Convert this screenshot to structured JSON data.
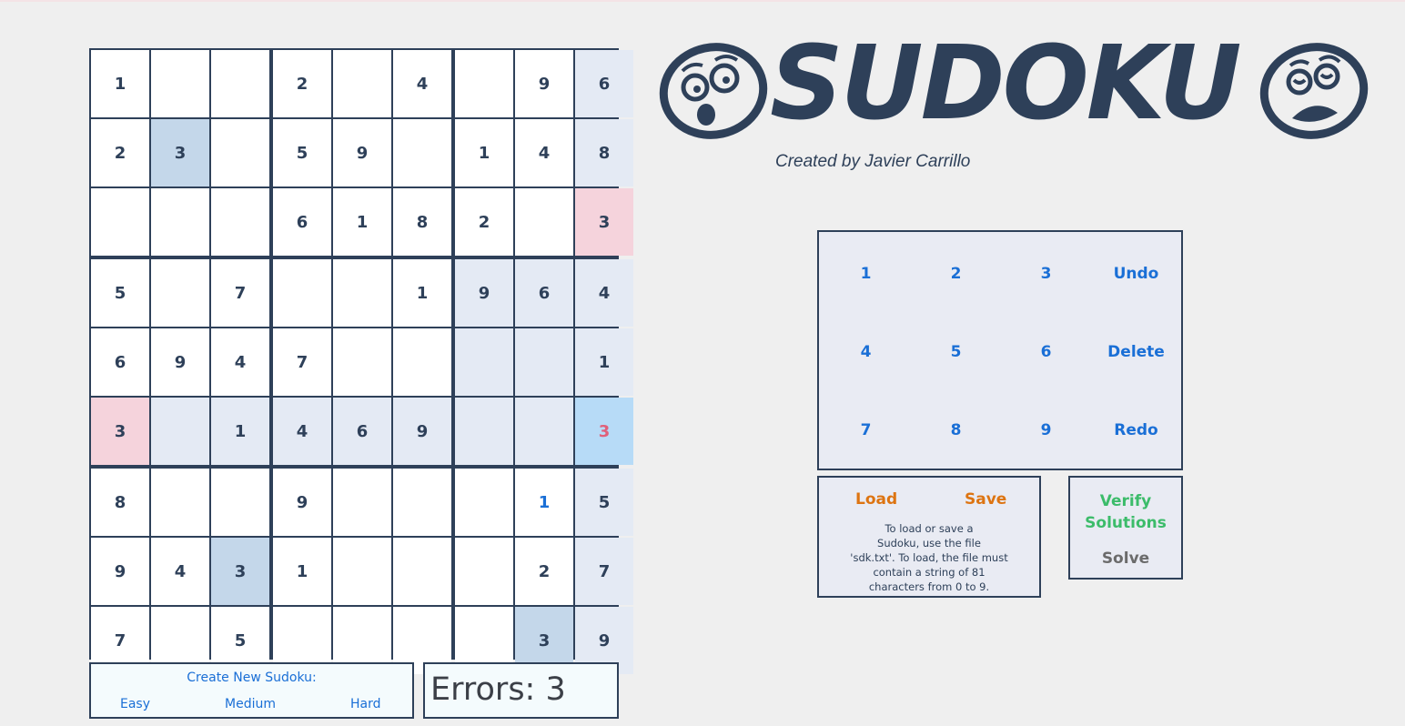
{
  "app": {
    "title": "SUDOKU",
    "credit": "Created by Javier Carrillo"
  },
  "board": {
    "cells": [
      [
        "1",
        "",
        "",
        "2",
        "",
        "4",
        "",
        "9",
        "6"
      ],
      [
        "2",
        "3",
        "",
        "5",
        "9",
        "",
        "1",
        "4",
        "8"
      ],
      [
        "",
        "",
        "",
        "6",
        "1",
        "8",
        "2",
        "",
        "3"
      ],
      [
        "5",
        "",
        "7",
        "",
        "",
        "1",
        "9",
        "6",
        "4"
      ],
      [
        "6",
        "9",
        "4",
        "7",
        "",
        "",
        "",
        "",
        "1"
      ],
      [
        "3",
        "",
        "1",
        "4",
        "6",
        "9",
        "",
        "",
        "3"
      ],
      [
        "8",
        "",
        "",
        "9",
        "",
        "",
        "",
        "1",
        "5"
      ],
      [
        "9",
        "4",
        "3",
        "1",
        "",
        "",
        "",
        "2",
        "7"
      ],
      [
        "7",
        "",
        "5",
        "",
        "",
        "",
        "",
        "3",
        "9"
      ]
    ],
    "fill": [
      [
        "w",
        "w",
        "w",
        "w",
        "w",
        "w",
        "w",
        "w",
        "l"
      ],
      [
        "w",
        "s",
        "w",
        "w",
        "w",
        "w",
        "w",
        "w",
        "l"
      ],
      [
        "w",
        "w",
        "w",
        "w",
        "w",
        "w",
        "w",
        "w",
        "e"
      ],
      [
        "w",
        "w",
        "w",
        "w",
        "w",
        "w",
        "l",
        "l",
        "l"
      ],
      [
        "w",
        "w",
        "w",
        "w",
        "w",
        "w",
        "l",
        "l",
        "l"
      ],
      [
        "e",
        "l",
        "l",
        "l",
        "l",
        "l",
        "l",
        "l",
        "x"
      ],
      [
        "w",
        "w",
        "w",
        "w",
        "w",
        "w",
        "w",
        "w",
        "l"
      ],
      [
        "w",
        "w",
        "s",
        "w",
        "w",
        "w",
        "w",
        "w",
        "l"
      ],
      [
        "w",
        "w",
        "w",
        "w",
        "w",
        "w",
        "w",
        "s",
        "l"
      ]
    ],
    "text_style": [
      [
        "g",
        "g",
        "g",
        "g",
        "g",
        "g",
        "g",
        "g",
        "g"
      ],
      [
        "g",
        "g",
        "g",
        "g",
        "g",
        "g",
        "g",
        "g",
        "g"
      ],
      [
        "g",
        "g",
        "g",
        "g",
        "g",
        "g",
        "g",
        "g",
        "g"
      ],
      [
        "g",
        "g",
        "g",
        "g",
        "g",
        "g",
        "g",
        "g",
        "g"
      ],
      [
        "g",
        "g",
        "g",
        "g",
        "g",
        "g",
        "g",
        "g",
        "g"
      ],
      [
        "g",
        "g",
        "g",
        "g",
        "g",
        "g",
        "g",
        "g",
        "r"
      ],
      [
        "g",
        "g",
        "g",
        "g",
        "g",
        "g",
        "g",
        "u",
        "g"
      ],
      [
        "g",
        "g",
        "g",
        "g",
        "g",
        "g",
        "g",
        "g",
        "g"
      ],
      [
        "g",
        "g",
        "g",
        "g",
        "g",
        "g",
        "g",
        "g",
        "g"
      ]
    ],
    "selected": [
      5,
      8
    ]
  },
  "new_sudoku": {
    "title": "Create New Sudoku:",
    "easy": "Easy",
    "medium": "Medium",
    "hard": "Hard"
  },
  "errors": {
    "label": "Errors:",
    "count": "3"
  },
  "keypad": {
    "keys": [
      "1",
      "2",
      "3",
      "Undo",
      "4",
      "5",
      "6",
      "Delete",
      "7",
      "8",
      "9",
      "Redo"
    ]
  },
  "file": {
    "load": "Load",
    "save": "Save",
    "note_lines": [
      "To load or save a",
      "Sudoku, use the file",
      "'sdk.txt'. To load, the file must",
      "contain a string of 81",
      "characters from 0 to 9."
    ]
  },
  "actions": {
    "verify_line1": "Verify",
    "verify_line2": "Solutions",
    "solve": "Solve"
  },
  "colors": {
    "navy": "#2e4059",
    "cell_white": "#ffffff",
    "cell_related": "#e4eaf4",
    "cell_same_number": "#c4d7ea",
    "cell_error": "#f5d3dc",
    "cell_selected": "#b7dbf7",
    "error_text": "#e0607a",
    "user_text": "#1a6fd6",
    "keypad_text": "#1a6fd6",
    "load_save": "#dd7411",
    "verify": "#3cbc6a",
    "solve": "#6b6b6b"
  },
  "icons": [
    "shocked-face-icon",
    "stressed-face-icon"
  ]
}
